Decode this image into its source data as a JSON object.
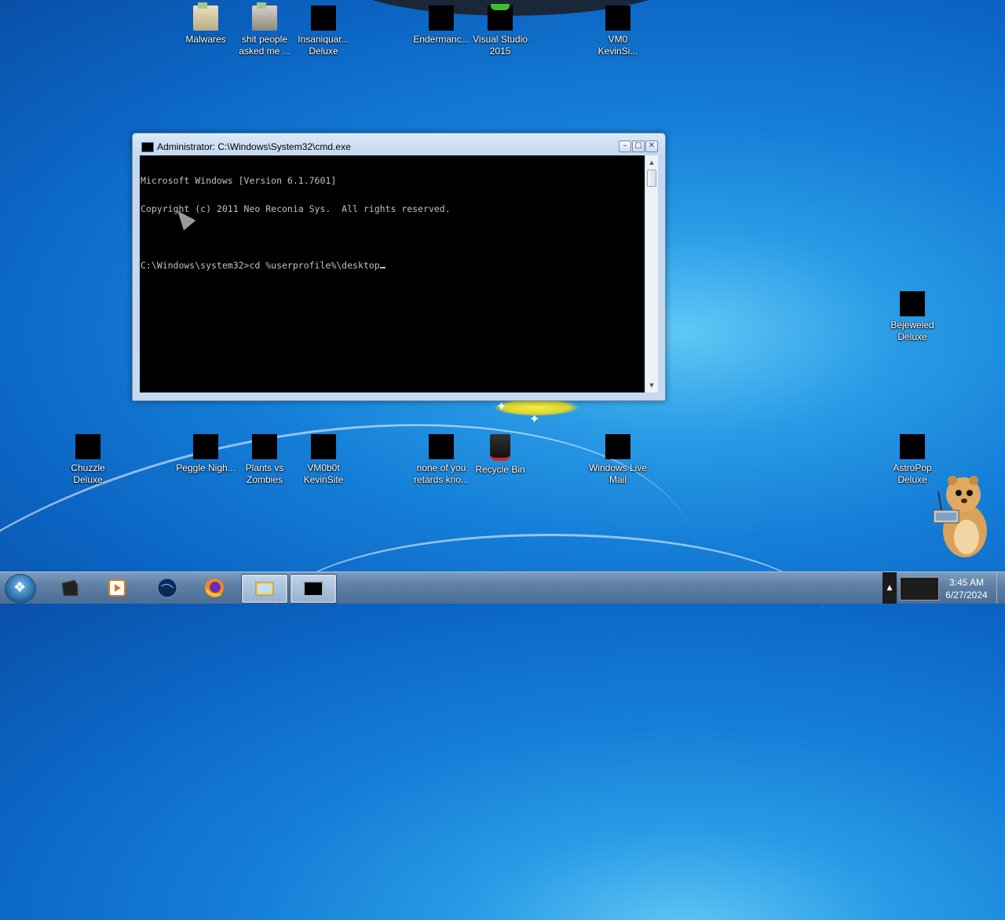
{
  "desktop": {
    "icons_top": [
      {
        "label": "Malwares",
        "icon": "folder-icon"
      },
      {
        "label": "shit people asked me ...",
        "icon": "folder-icon"
      },
      {
        "label": "Insaniquar... Deluxe",
        "icon": "app-icon"
      },
      {
        "label": "Endermanc...",
        "icon": "app-icon"
      },
      {
        "label": "Visual Studio 2015",
        "icon": "visual-studio-icon"
      },
      {
        "label": "VM0 KevinSi...",
        "icon": "app-icon"
      }
    ],
    "icons_right": [
      {
        "label": "Bejeweled Deluxe",
        "icon": "app-icon"
      }
    ],
    "icons_bottom": [
      {
        "label": "Chuzzle Deluxe",
        "icon": "app-icon"
      },
      {
        "label": "Peggle Nigh...",
        "icon": "app-icon"
      },
      {
        "label": "Plants vs Zombies",
        "icon": "app-icon"
      },
      {
        "label": "VM0b0t KevinSite",
        "icon": "app-icon"
      },
      {
        "label": "none of you retards kno...",
        "icon": "app-icon"
      },
      {
        "label": "Recycle Bin",
        "icon": "recycle-bin-icon"
      },
      {
        "label": "Windows Live Mail",
        "icon": "app-icon"
      },
      {
        "label": "AstroPop Deluxe",
        "icon": "app-icon"
      }
    ]
  },
  "cmd_window": {
    "title": "Administrator: C:\\Windows\\System32\\cmd.exe",
    "lines": [
      "Microsoft Windows [Version 6.1.7601]",
      "Copyright (c) 2011 Neo Reconia Sys.  All rights reserved.",
      "",
      "C:\\Windows\\system32>cd %userprofile%\\desktop"
    ],
    "buttons": {
      "minimize": "–",
      "maximize": "□",
      "close": "✕"
    }
  },
  "taskbar": {
    "items": [
      {
        "icon": "terminal-app-icon",
        "active": false
      },
      {
        "icon": "media-player-icon",
        "active": false
      },
      {
        "icon": "globe-icon",
        "active": false
      },
      {
        "icon": "firefox-icon",
        "active": false
      },
      {
        "icon": "explorer-icon",
        "active": true
      },
      {
        "icon": "cmd-icon",
        "active": true
      }
    ],
    "clock": {
      "time": "3:45 AM",
      "date": "6/27/2024"
    }
  },
  "colors": {
    "desktop": "#157fd8",
    "console_bg": "#000000",
    "console_text": "#c0c0c0",
    "taskbar": "#5d7ea4"
  }
}
